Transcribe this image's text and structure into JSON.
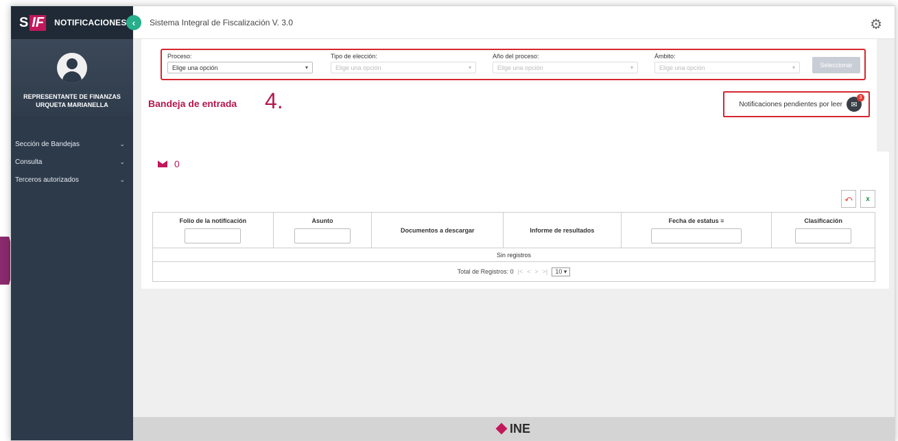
{
  "sidebar": {
    "logo": {
      "s": "S",
      "if": "IF"
    },
    "app_name": "NOTIFICACIONES",
    "collapse_icon": "‹",
    "role": "REPRESENTANTE DE FINANZAS",
    "user_name": "URQUETA MARIANELLA",
    "menu": [
      {
        "label": "Sección de Bandejas"
      },
      {
        "label": "Consulta"
      },
      {
        "label": "Terceros autorizados"
      }
    ]
  },
  "topbar": {
    "title": "Sistema Integral de Fiscalización V. 3.0",
    "settings_icon": "gear-icon"
  },
  "filters": {
    "proceso": {
      "label": "Proceso:",
      "value": "Elige una opción"
    },
    "tipo": {
      "label": "Tipo de elección:",
      "value": "Elige una opción"
    },
    "anio": {
      "label": "Año del proceso:",
      "value": "Elige una opción"
    },
    "ambito": {
      "label": "Ámbito:",
      "value": "Elige una opción"
    },
    "button": "Seleccionar"
  },
  "inbox": {
    "title": "Bandeja de entrada",
    "step_marker": "4.",
    "pending_label": "Notificaciones pendientes por leer",
    "pending_count": "3",
    "mail_count": "0"
  },
  "table": {
    "headers": [
      {
        "label": "Folio de la notificación"
      },
      {
        "label": "Asunto"
      },
      {
        "label": "Documentos a descargar"
      },
      {
        "label": "Informe de resultados"
      },
      {
        "label": "Fecha de estatus"
      },
      {
        "label": "Clasificación"
      }
    ],
    "empty_text": "Sin registros",
    "total_label": "Total de Registros: 0",
    "page_size": "10"
  },
  "footer": {
    "brand": "INE"
  },
  "colors": {
    "sidebar": "#2d3a4a",
    "accent": "#c2185b",
    "highlight_border": "#d5252f",
    "toggle": "#27ae8a"
  }
}
